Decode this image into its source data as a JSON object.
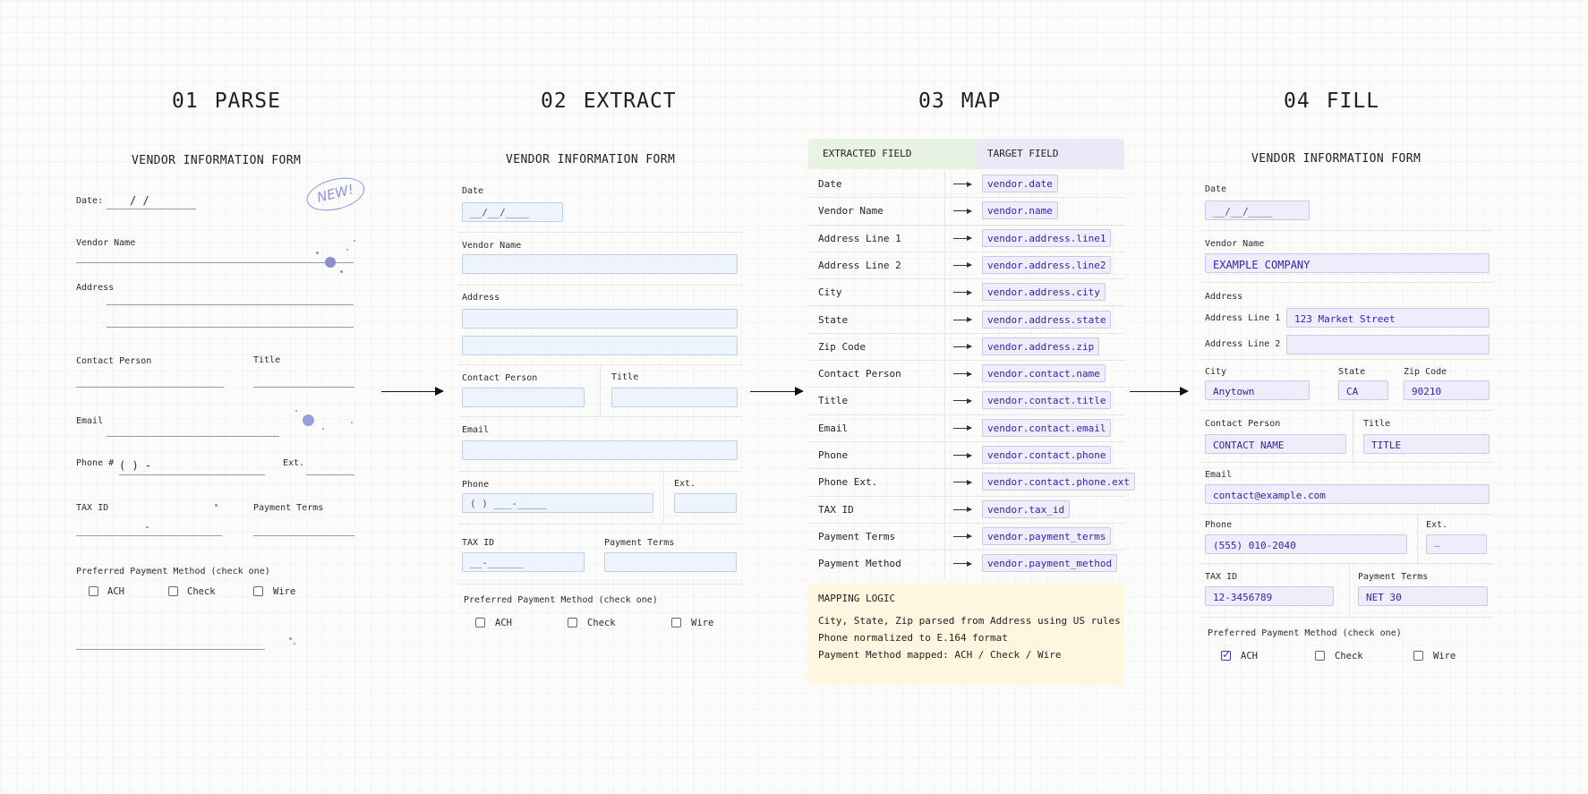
{
  "steps": [
    {
      "num": "01",
      "name": "PARSE"
    },
    {
      "num": "02",
      "name": "EXTRACT"
    },
    {
      "num": "03",
      "name": "MAP"
    },
    {
      "num": "04",
      "name": "FILL"
    }
  ],
  "parse": {
    "title": "VENDOR INFORMATION FORM",
    "date_label": "Date:",
    "date_slashes": "/     /",
    "vendor_name": "Vendor Name",
    "address": "Address",
    "contact_person": "Contact Person",
    "title_label": "Title",
    "email": "Email",
    "phone": "Phone #",
    "phone_pattern": "(        )        -",
    "ext": "Ext.",
    "tax_id": "TAX ID",
    "payment_terms": "Payment Terms",
    "preferred": "Preferred Payment Method (check one)",
    "options": [
      "ACH",
      "Check",
      "Wire"
    ],
    "stamp": "NEW!"
  },
  "extract": {
    "title": "VENDOR INFORMATION FORM",
    "date": "Date",
    "date_placeholder": "__/__/____",
    "vendor_name": "Vendor Name",
    "address": "Address",
    "contact_person": "Contact Person",
    "title_label": "Title",
    "email": "Email",
    "phone": "Phone",
    "phone_placeholder": "(     ) ___-_____",
    "ext": "Ext.",
    "tax_id": "TAX ID",
    "tax_placeholder": "__-______",
    "payment_terms": "Payment Terms",
    "preferred": "Preferred Payment Method (check one)",
    "options": [
      "ACH",
      "Check",
      "Wire"
    ]
  },
  "map": {
    "col_extracted": "EXTRACTED FIELD",
    "col_target": "TARGET FIELD",
    "rows": [
      {
        "src": "Date",
        "tgt": "vendor.date"
      },
      {
        "src": "Vendor Name",
        "tgt": "vendor.name"
      },
      {
        "src": "Address Line 1",
        "tgt": "vendor.address.line1"
      },
      {
        "src": "Address Line 2",
        "tgt": "vendor.address.line2"
      },
      {
        "src": "City",
        "tgt": "vendor.address.city"
      },
      {
        "src": "State",
        "tgt": "vendor.address.state"
      },
      {
        "src": "Zip Code",
        "tgt": "vendor.address.zip"
      },
      {
        "src": "Contact Person",
        "tgt": "vendor.contact.name"
      },
      {
        "src": "Title",
        "tgt": "vendor.contact.title"
      },
      {
        "src": "Email",
        "tgt": "vendor.contact.email"
      },
      {
        "src": "Phone",
        "tgt": "vendor.contact.phone"
      },
      {
        "src": "Phone Ext.",
        "tgt": "vendor.contact.phone.ext"
      },
      {
        "src": "TAX ID",
        "tgt": "vendor.tax_id"
      },
      {
        "src": "Payment Terms",
        "tgt": "vendor.payment_terms"
      },
      {
        "src": "Payment Method",
        "tgt": "vendor.payment_method"
      }
    ],
    "logic_title": "MAPPING LOGIC",
    "logic_lines": [
      "City, State, Zip parsed from Address using US rules",
      "Phone normalized to E.164 format",
      "Payment Method mapped: ACH / Check / Wire"
    ]
  },
  "fill": {
    "title": "VENDOR INFORMATION FORM",
    "date": "Date",
    "date_value": "__/__/____",
    "vendor_name": "Vendor Name",
    "vendor_value": "EXAMPLE COMPANY",
    "address": "Address",
    "line1_label": "Address Line 1",
    "line1_value": "123 Market Street",
    "line2_label": "Address Line 2",
    "line2_value": "",
    "city": "City",
    "city_value": "Anytown",
    "state": "State",
    "state_value": "CA",
    "zip": "Zip Code",
    "zip_value": "90210",
    "contact_person": "Contact Person",
    "contact_value": "CONTACT NAME",
    "title_label": "Title",
    "title_value": "TITLE",
    "email": "Email",
    "email_value": "contact@example.com",
    "phone": "Phone",
    "phone_value": "(555) 010-2040",
    "ext": "Ext.",
    "ext_value": "—",
    "tax_id": "TAX ID",
    "tax_value": "12-3456789",
    "payment_terms": "Payment Terms",
    "terms_value": "NET 30",
    "preferred": "Preferred Payment Method (check one)",
    "options": [
      "ACH",
      "Check",
      "Wire"
    ],
    "selected_option": "ACH"
  },
  "colors": {
    "extract_field_bg": "#eef4fe",
    "fill_field_bg": "#efedfb",
    "fill_text": "#2a28a8",
    "map_header_left": "#e9f3e4",
    "map_header_right": "#ece8f7",
    "logic_bg": "#fff6df"
  }
}
